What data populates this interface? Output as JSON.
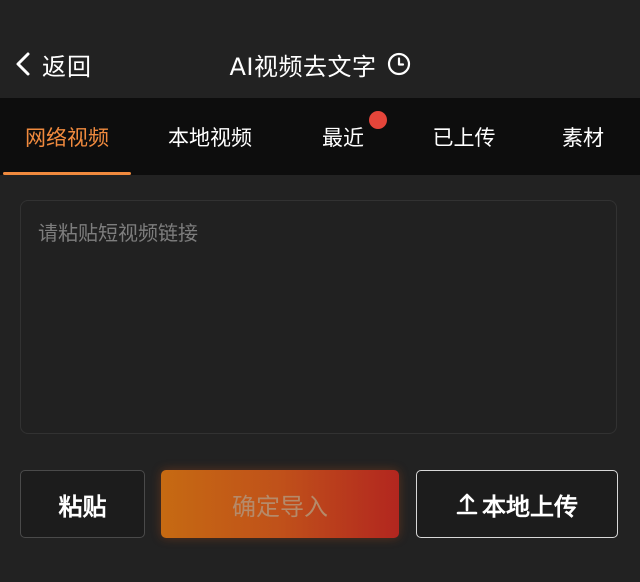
{
  "header": {
    "back_label": "返回",
    "title": "AI视频去文字",
    "history_icon": "clock-icon",
    "back_icon": "chevron-left-icon"
  },
  "tabs": [
    {
      "label": "网络视频",
      "active": true
    },
    {
      "label": "本地视频",
      "active": false
    },
    {
      "label": "最近",
      "active": false,
      "has_dot": true
    },
    {
      "label": "已上传",
      "active": false
    },
    {
      "label": "素材",
      "active": false
    }
  ],
  "input": {
    "placeholder": "请粘贴短视频链接",
    "value": ""
  },
  "actions": {
    "paste_label": "粘贴",
    "confirm_label": "确定导入",
    "upload_label": "本地上传",
    "upload_icon": "upload-icon"
  },
  "colors": {
    "accent": "#f08a3e",
    "badge": "#e5453a",
    "background": "#222222",
    "tabbar": "#0d0d0d"
  }
}
